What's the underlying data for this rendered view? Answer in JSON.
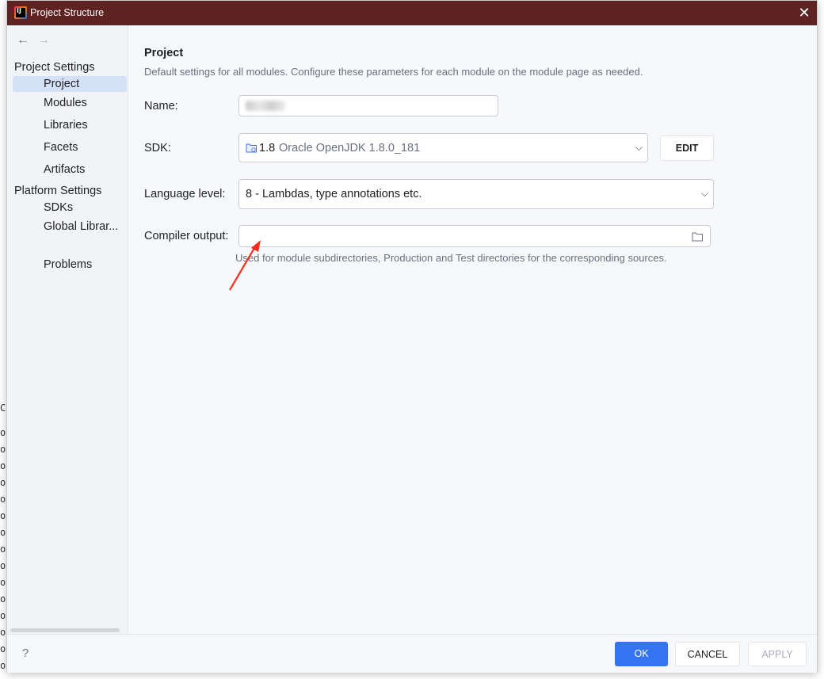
{
  "window": {
    "title": "Project Structure"
  },
  "sidebar": {
    "back_icon": "arrow-left-icon",
    "forward_icon": "arrow-right-icon",
    "project_settings_title": "Project Settings",
    "project_settings_items": [
      {
        "label": "Project",
        "selected": true
      },
      {
        "label": "Modules"
      },
      {
        "label": "Libraries"
      },
      {
        "label": "Facets"
      },
      {
        "label": "Artifacts"
      }
    ],
    "platform_settings_title": "Platform Settings",
    "platform_settings_items": [
      {
        "label": "SDKs"
      },
      {
        "label": "Global Librar..."
      }
    ],
    "problems_label": "Problems"
  },
  "main": {
    "title": "Project",
    "description": "Default settings for all modules. Configure these parameters for each module on the module page as needed.",
    "name_label": "Name:",
    "name_value": "",
    "sdk_label": "SDK:",
    "sdk_version": "1.8",
    "sdk_name": "Oracle OpenJDK 1.8.0_181",
    "edit_label": "EDIT",
    "language_level_label": "Language level:",
    "language_level_value": "8 - Lambdas, type annotations etc.",
    "compiler_output_label": "Compiler output:",
    "compiler_output_value": "",
    "compiler_output_hint": "Used for module subdirectories, Production and Test directories for the corresponding sources."
  },
  "footer": {
    "help_label": "?",
    "ok_label": "OK",
    "cancel_label": "CANCEL",
    "apply_label": "APPLY"
  },
  "colors": {
    "titlebar": "#5e2321",
    "accent": "#3574f0",
    "selection": "#d5e1f6",
    "annotation_arrow": "#ff2a1a"
  }
}
